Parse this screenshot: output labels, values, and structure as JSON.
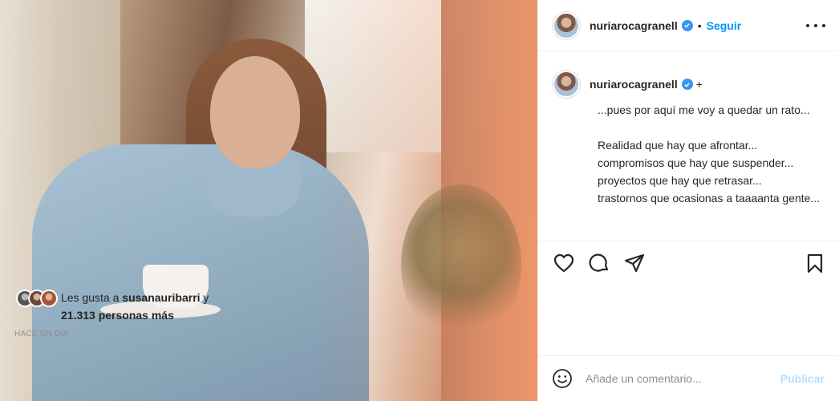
{
  "header": {
    "username": "nuriarocagranell",
    "separator": "•",
    "follow_label": "Seguir"
  },
  "caption": {
    "username": "nuriarocagranell",
    "plus": "+",
    "text": "...pues por aquí me voy a quedar un rato...\n\nRealidad que hay que afrontar...\ncompromisos que hay que suspender...\nproyectos que hay que retrasar...\ntrastornos que ocasionas a taaaanta gente..."
  },
  "likes": {
    "prefix": "Les gusta a ",
    "user": "susanauribarri",
    "joiner": " y",
    "others": "21.313 personas más"
  },
  "timestamp": "Hace un día",
  "comment_box": {
    "placeholder": "Añade un comentario...",
    "publish_label": "Publicar"
  },
  "colors": {
    "accent": "#0095f6",
    "publish_disabled": "#b2dffc",
    "verified": "#3897f0",
    "muted": "#8e8e8e"
  },
  "icons": [
    "verified-badge-icon",
    "more-options-icon",
    "heart-icon",
    "comment-icon",
    "share-icon",
    "save-icon",
    "emoji-icon"
  ]
}
